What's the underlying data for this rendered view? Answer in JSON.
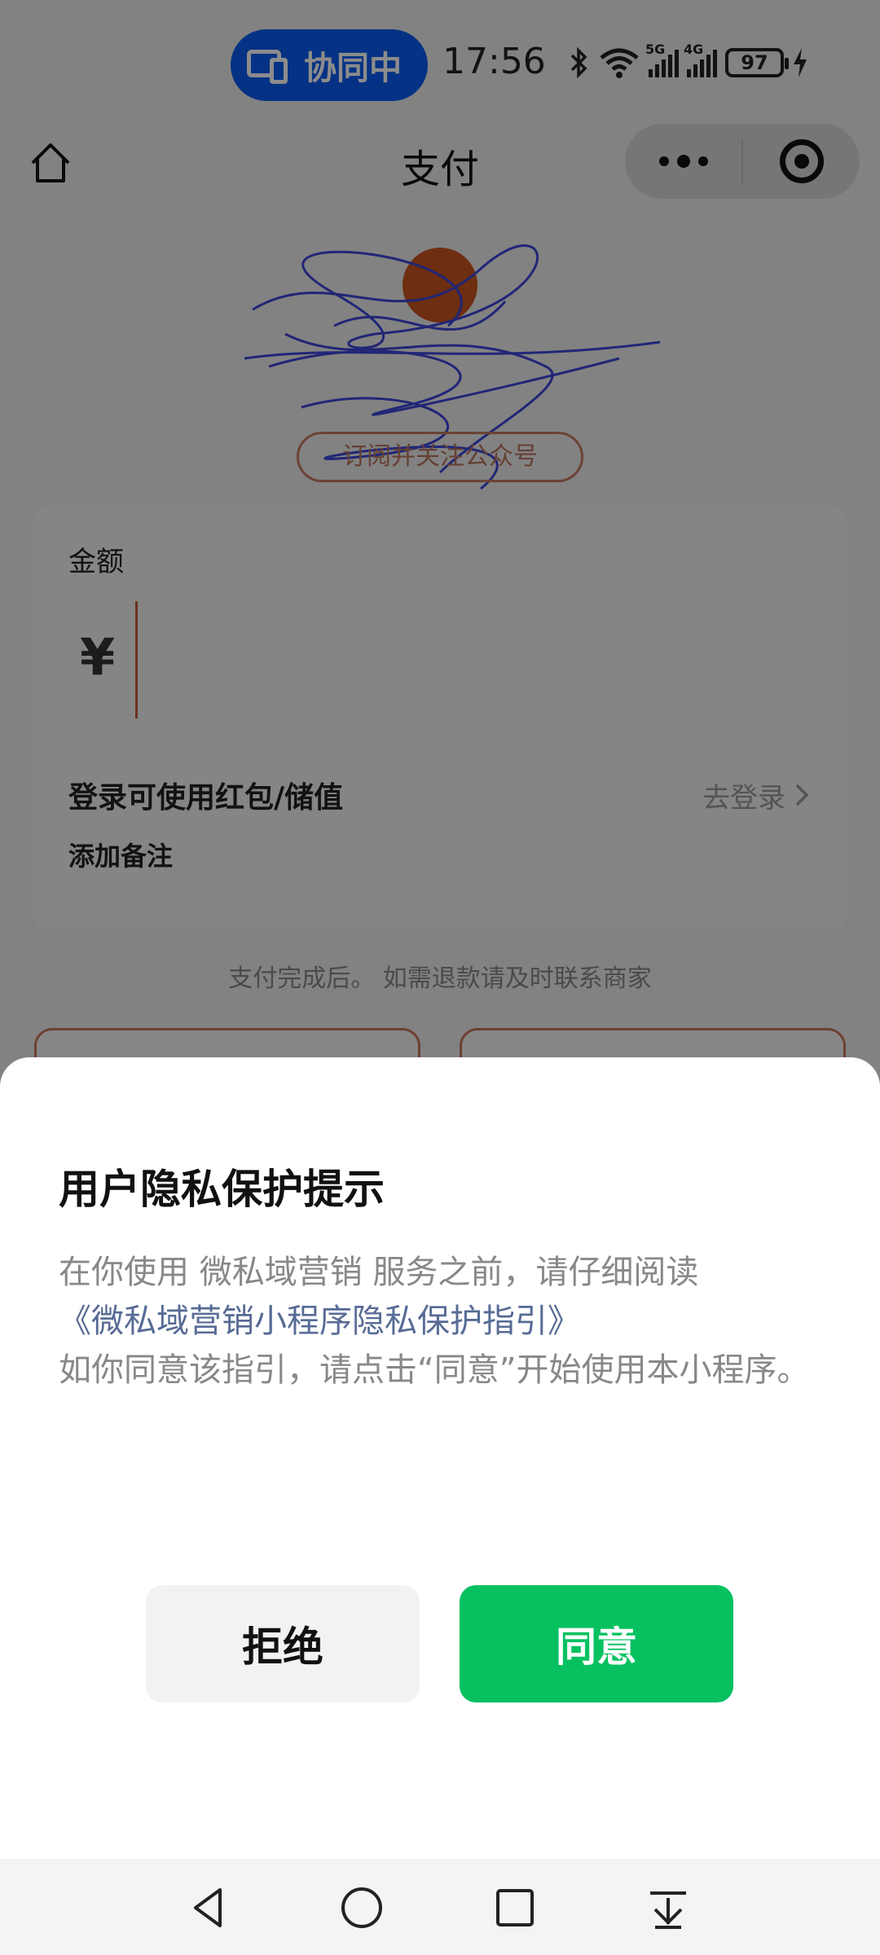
{
  "status_bar": {
    "collab_label": "协同中",
    "time": "17:56",
    "signal_1_label": "5G",
    "signal_2_label": "4G",
    "battery": "97"
  },
  "nav": {
    "title": "支付"
  },
  "merchant": {
    "subscribe_label": "订阅并关注公众号"
  },
  "amount_card": {
    "amount_label": "金额",
    "currency_symbol": "¥",
    "login_text": "登录可使用红包/储值",
    "login_link": "去登录",
    "note_label": "添加备注"
  },
  "refund_tip": "支付完成后。 如需退款请及时联系商家",
  "privacy_sheet": {
    "title": "用户隐私保护提示",
    "line1": "在你使用 微私域营销 服务之前，请仔细阅读",
    "link": "《微私域营销小程序隐私保护指引》",
    "line2": "如你同意该指引，请点击“同意”开始使用本小程序。",
    "reject_label": "拒绝",
    "agree_label": "同意"
  },
  "colors": {
    "agree_green": "#07c160",
    "link_blue": "#576b95",
    "collab_blue": "#0a5cf0",
    "accent_orange": "#c9735a"
  }
}
